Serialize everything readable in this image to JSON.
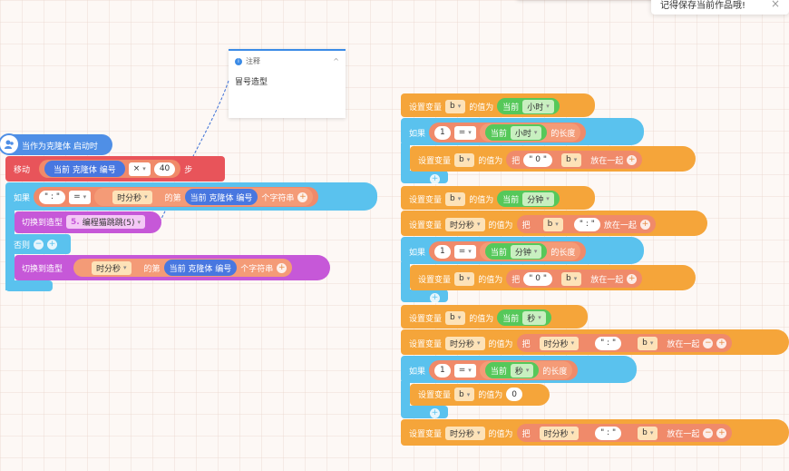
{
  "toast": {
    "text": "记得保存当前作品哦!",
    "close": "×"
  },
  "note": {
    "title": "注释",
    "body": "冒号造型",
    "info": "i",
    "collapse": "^"
  },
  "hat": {
    "label": "当作为克隆体 启动时"
  },
  "left": {
    "move": {
      "label": "移动",
      "clone_id": "当前 克隆体 编号",
      "op": "×",
      "num": "40",
      "unit": "步"
    },
    "if": {
      "label": "如果",
      "str": "\" : \"",
      "eq": "=",
      "var": "时分秒",
      "of_text": "的第",
      "clone_id": "当前 克隆体 编号",
      "char_text": "个字符串"
    },
    "switch1": {
      "label": "切换到造型",
      "num": "5.",
      "costume": "编程猫跳跳(5)"
    },
    "else": {
      "label": "否则"
    },
    "switch2": {
      "label": "切换到造型",
      "var": "时分秒",
      "of_text": "的第",
      "clone_id": "当前 克隆体 编号",
      "char_text": "个字符串"
    }
  },
  "right": {
    "set_label": "设置变量",
    "value_of": "的值为",
    "current": "当前",
    "hour": "小时",
    "minute": "分钟",
    "second": "秒",
    "length_of": "的长度",
    "if_label": "如果",
    "join": "把",
    "join_end": "放在一起",
    "var_b": "b",
    "var_hms": "时分秒",
    "one": "1",
    "eq": "=",
    "zero_str": "\" 0 \"",
    "colon_str": "\" : \"",
    "zero": "0"
  }
}
